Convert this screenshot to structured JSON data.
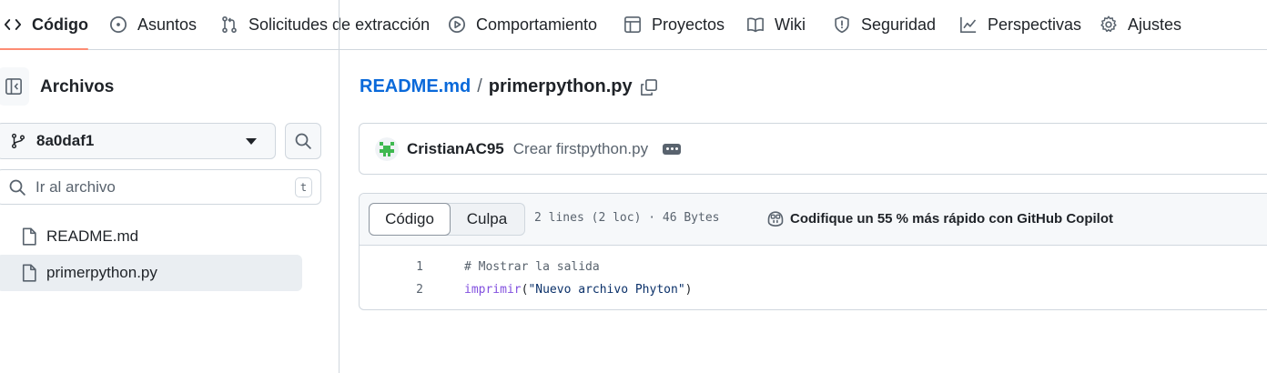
{
  "nav": {
    "tabs": [
      {
        "label": "Código",
        "icon": "code-icon",
        "active": true
      },
      {
        "label": "Asuntos",
        "icon": "issue-icon"
      },
      {
        "label": "Solicitudes de extracción",
        "icon": "pull-request-icon"
      },
      {
        "label": "Comportamiento",
        "icon": "play-icon"
      },
      {
        "label": "Proyectos",
        "icon": "table-icon"
      },
      {
        "label": "Wiki",
        "icon": "book-icon"
      },
      {
        "label": "Seguridad",
        "icon": "shield-icon"
      },
      {
        "label": "Perspectivas",
        "icon": "graph-icon"
      },
      {
        "label": "Ajustes",
        "icon": "gear-icon"
      }
    ]
  },
  "sidebar": {
    "title": "Archivos",
    "branch": "8a0daf1",
    "goto_placeholder": "Ir al archivo",
    "goto_shortcut": "t",
    "files": [
      {
        "name": "README.md",
        "selected": false
      },
      {
        "name": "primerpython.py",
        "selected": true
      }
    ]
  },
  "breadcrumb": {
    "repo": "README.md",
    "separator": "/",
    "file": "primerpython.py"
  },
  "commit": {
    "author": "CristianAC95",
    "message": "Crear firstpython.py"
  },
  "file_view": {
    "tab_code": "Código",
    "tab_blame": "Culpa",
    "meta": "2 lines (2 loc) · 46 Bytes",
    "copilot": "Codifique un 55 % más rápido con GitHub Copilot",
    "lines": [
      {
        "num": "1",
        "comment": "# Mostrar la salida"
      },
      {
        "num": "2",
        "fn": "imprimir",
        "open": "(",
        "str": "\"Nuevo archivo Phyton\"",
        "close": ")"
      }
    ]
  },
  "colors": {
    "link": "#0969da",
    "active_underline": "#fd8c73",
    "keyword_fn": "#8250df",
    "string": "#0a3069",
    "avatar": "#3fb950"
  }
}
